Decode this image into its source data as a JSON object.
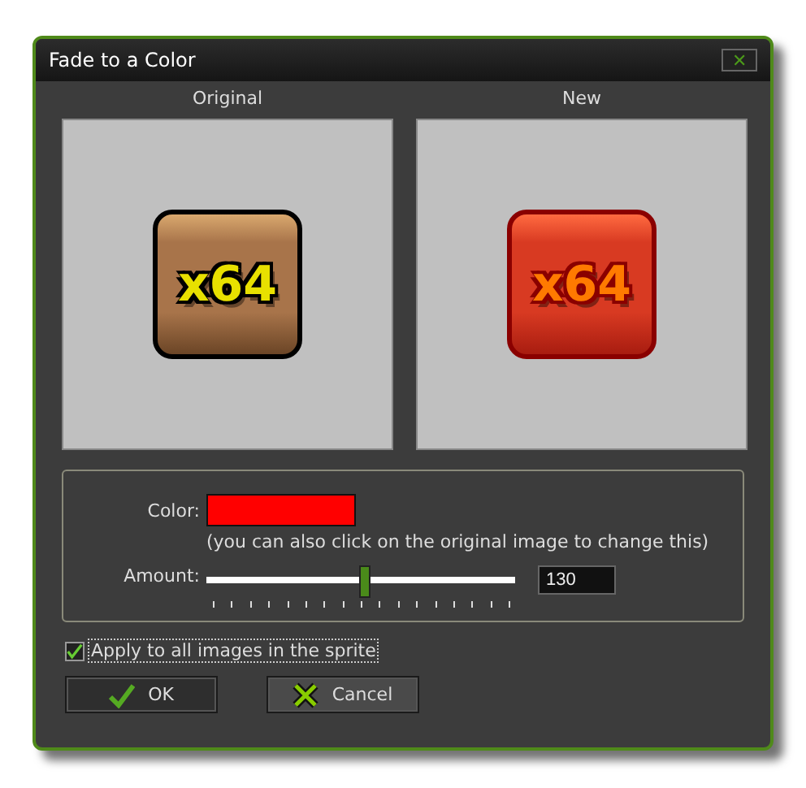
{
  "window": {
    "title": "Fade to a Color",
    "close": "✕"
  },
  "previews": [
    {
      "label": "Original",
      "kind": "original",
      "sprite_text": "x64"
    },
    {
      "label": "New",
      "kind": "faded",
      "sprite_text": "x64"
    }
  ],
  "settings": {
    "color_label": "Color:",
    "color": "#ff0000",
    "hint": "(you can also click on the original image to change this)",
    "amount_label": "Amount:",
    "amount": {
      "level": 0.51,
      "value": "130"
    }
  },
  "apply_all": {
    "label": "Apply to all images in the sprite",
    "checked": true
  },
  "buttons": [
    {
      "label": "OK",
      "kind": "ok"
    },
    {
      "label": "Cancel",
      "kind": "cancel"
    }
  ]
}
